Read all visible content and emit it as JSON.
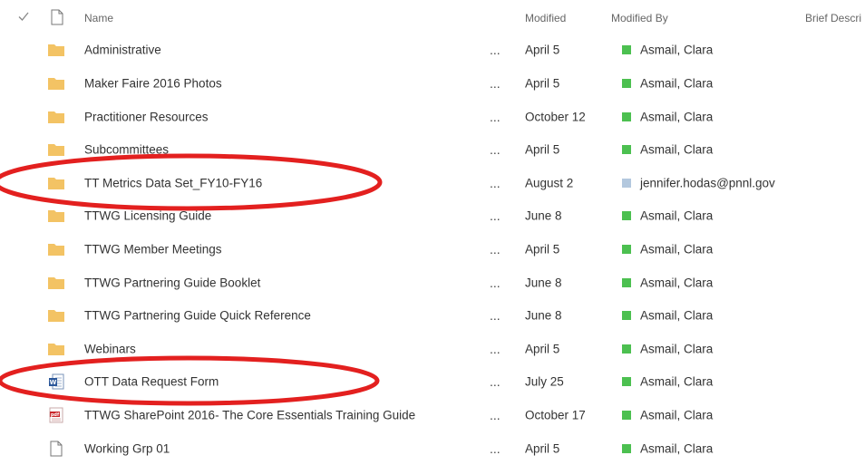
{
  "colors": {
    "folder": "#f3c364",
    "presence_online": "#4cc050",
    "presence_unknown": "#b3c8de",
    "highlight_ellipse": "#e3201f",
    "header_text": "#666666",
    "row_text": "#333333"
  },
  "header": {
    "check_icon": "check-icon",
    "doc_icon": "document-icon",
    "name": "Name",
    "modified": "Modified",
    "modified_by": "Modified By",
    "brief_description": "Brief Descri"
  },
  "rows": [
    {
      "type": "folder",
      "name": "Administrative",
      "more": "...",
      "modified": "April 5",
      "modified_by": "Asmail, Clara",
      "presence": "online"
    },
    {
      "type": "folder",
      "name": "Maker Faire 2016 Photos",
      "more": "...",
      "modified": "April 5",
      "modified_by": "Asmail, Clara",
      "presence": "online"
    },
    {
      "type": "folder",
      "name": "Practitioner Resources",
      "more": "...",
      "modified": "October 12",
      "modified_by": "Asmail, Clara",
      "presence": "online"
    },
    {
      "type": "folder",
      "name": "Subcommittees",
      "more": "...",
      "modified": "April 5",
      "modified_by": "Asmail, Clara",
      "presence": "online"
    },
    {
      "type": "folder",
      "name": "TT Metrics Data Set_FY10-FY16",
      "more": "...",
      "modified": "August 2",
      "modified_by": "jennifer.hodas@pnnl.gov",
      "presence": "unknown",
      "highlighted": true
    },
    {
      "type": "folder",
      "name": "TTWG Licensing Guide",
      "more": "...",
      "modified": "June 8",
      "modified_by": "Asmail, Clara",
      "presence": "online"
    },
    {
      "type": "folder",
      "name": "TTWG Member Meetings",
      "more": "...",
      "modified": "April 5",
      "modified_by": "Asmail, Clara",
      "presence": "online"
    },
    {
      "type": "folder",
      "name": "TTWG Partnering Guide Booklet",
      "more": "...",
      "modified": "June 8",
      "modified_by": "Asmail, Clara",
      "presence": "online"
    },
    {
      "type": "folder",
      "name": "TTWG Partnering Guide Quick Reference",
      "more": "...",
      "modified": "June 8",
      "modified_by": "Asmail, Clara",
      "presence": "online"
    },
    {
      "type": "folder",
      "name": "Webinars",
      "more": "...",
      "modified": "April 5",
      "modified_by": "Asmail, Clara",
      "presence": "online"
    },
    {
      "type": "word",
      "name": "OTT Data Request Form",
      "more": "...",
      "modified": "July 25",
      "modified_by": "Asmail, Clara",
      "presence": "online",
      "highlighted": true
    },
    {
      "type": "pdf",
      "name": "TTWG SharePoint 2016- The Core Essentials Training Guide",
      "more": "...",
      "modified": "October 17",
      "modified_by": "Asmail, Clara",
      "presence": "online"
    },
    {
      "type": "file",
      "name": "Working Grp 01",
      "more": "...",
      "modified": "April 5",
      "modified_by": "Asmail, Clara",
      "presence": "online"
    }
  ]
}
